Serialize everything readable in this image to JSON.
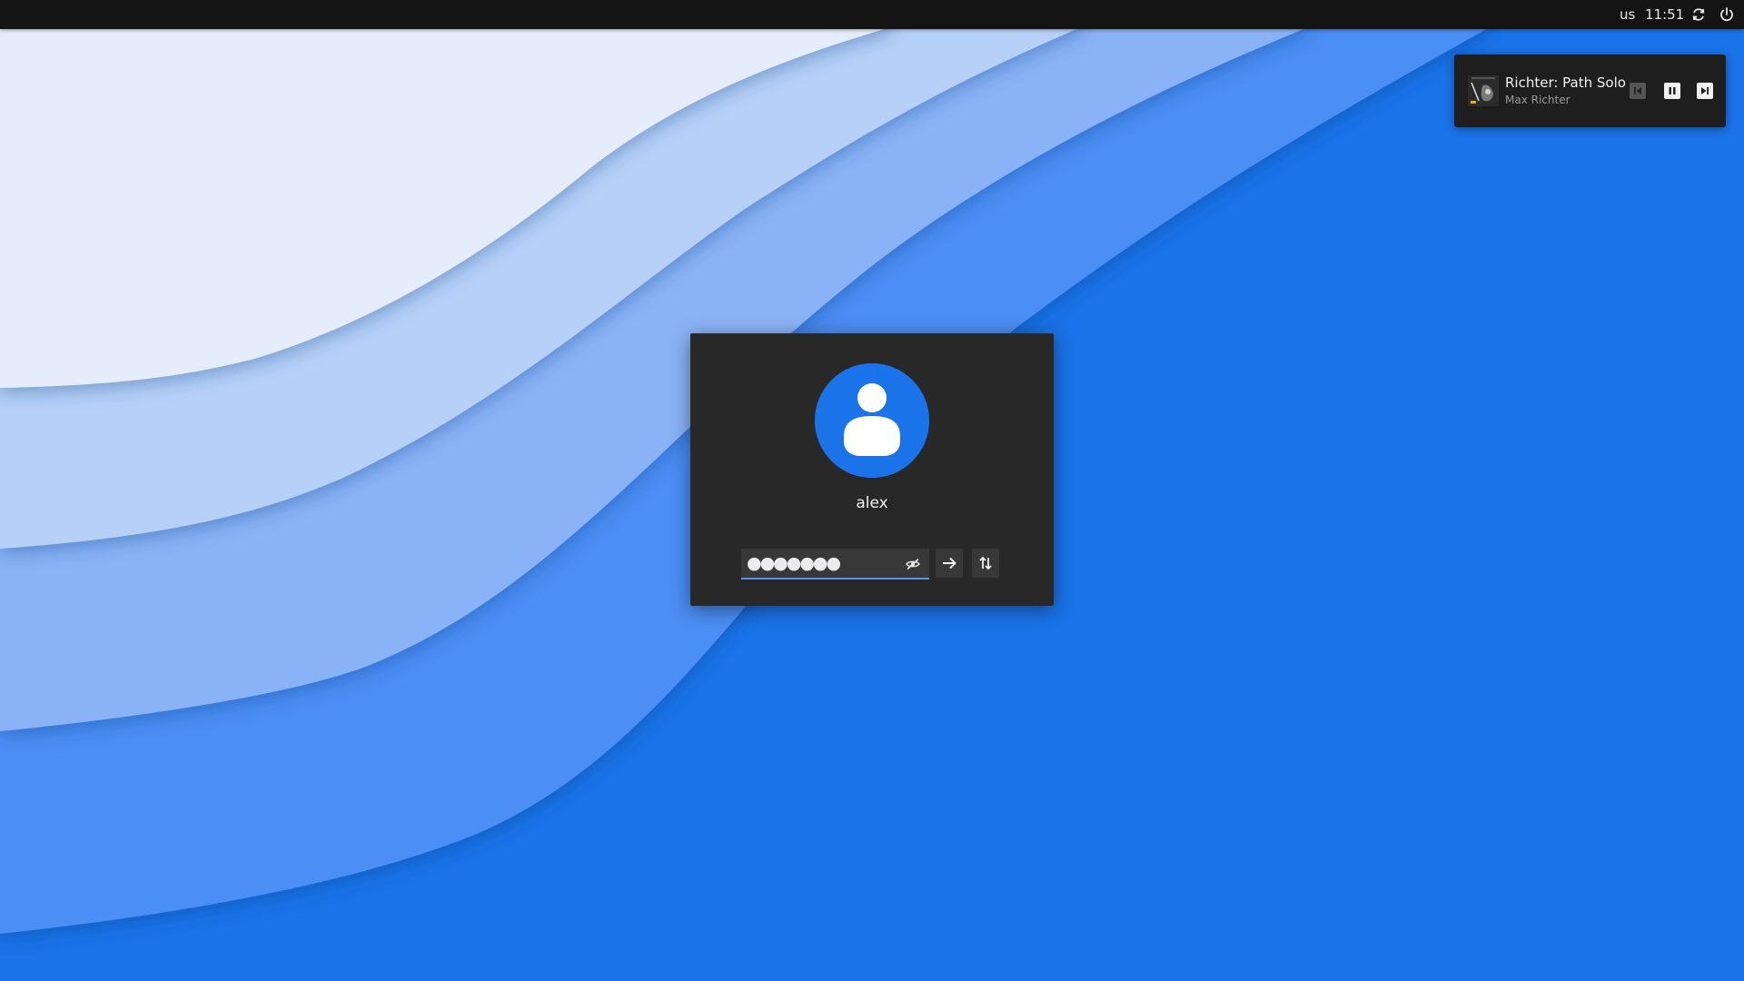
{
  "topbar": {
    "keyboard_layout": "us",
    "clock": "11:51",
    "icons": [
      "sync-icon",
      "power-icon"
    ]
  },
  "media_player": {
    "title": "Richter: Path Solo",
    "artist": "Max Richter",
    "controls": [
      "previous-icon",
      "pause-icon",
      "next-icon"
    ]
  },
  "login": {
    "username": "alex",
    "password_mask": "●●●●●●●",
    "icons": [
      "avatar-icon",
      "hide-password-icon",
      "arrow-right-icon",
      "switch-user-icon"
    ]
  },
  "colors": {
    "accent": "#1a73e8",
    "card_background": "#282828",
    "topbar_background": "#141414",
    "input_underline": "#5b8ff0"
  }
}
